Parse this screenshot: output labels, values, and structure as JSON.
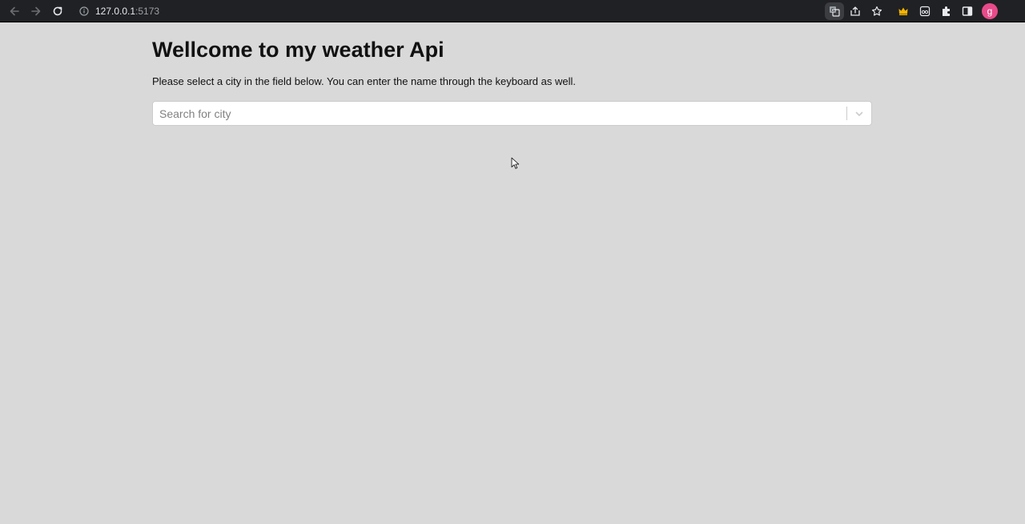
{
  "browser": {
    "url_host": "127.0.0.1",
    "url_port": ":5173",
    "profile_initial": "g",
    "icons": {
      "back": "arrow-left-icon",
      "forward": "arrow-right-icon",
      "reload": "reload-icon",
      "info": "info-icon",
      "translate": "translate-icon",
      "share": "share-icon",
      "bookmark": "star-icon",
      "crown": "crown-icon",
      "incognito": "glasses-icon",
      "extensions": "puzzle-icon",
      "side_panel": "side-panel-icon"
    },
    "colors": {
      "toolbar": "#202124",
      "avatar": "#e84a8a",
      "crown": "#f5b400"
    }
  },
  "page": {
    "title": "Wellcome to my weather Api",
    "description": "Please select a city in the field below. You can enter the name through the keyboard as well.",
    "search": {
      "placeholder": "Search for city",
      "value": ""
    },
    "background_color": "#d9d9d9"
  }
}
